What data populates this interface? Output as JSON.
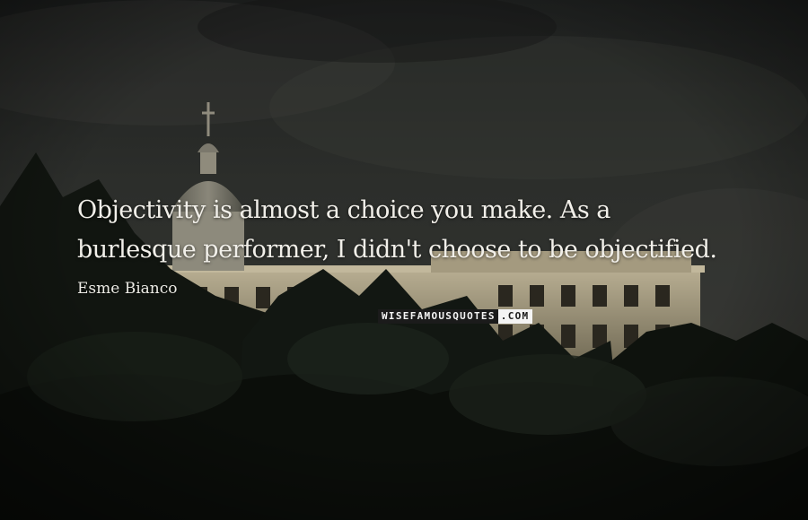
{
  "quote": {
    "line1": "Objectivity is almost a choice you make. As a",
    "line2": "burlesque performer, I didn't choose to be objectified."
  },
  "author": "Esme Bianco",
  "watermark": {
    "part1": "WISEFAMOUSQUOTES",
    "part2": ".COM"
  },
  "colors": {
    "sky": "#252725",
    "foliage": "#0f130e",
    "palace": "#a59a7e",
    "text": "#f1efe9"
  }
}
